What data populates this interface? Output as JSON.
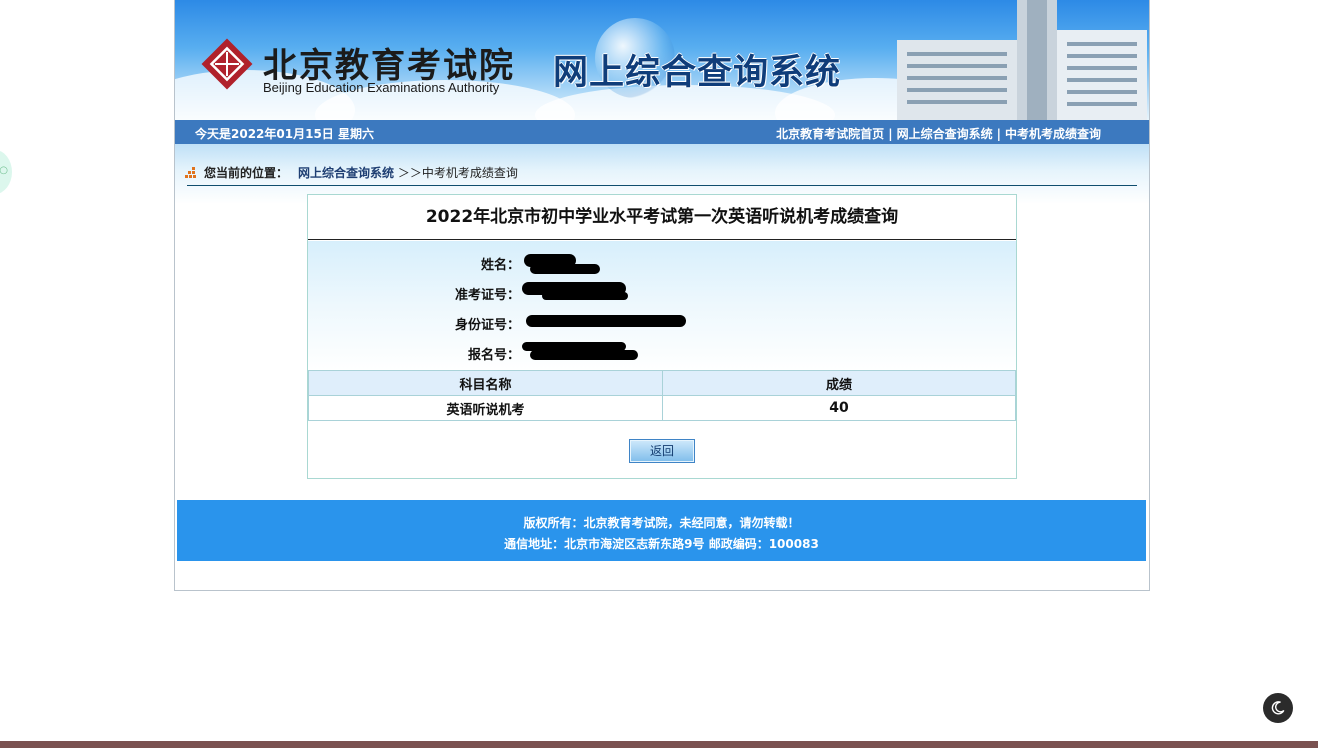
{
  "header": {
    "logo_cn": "北京教育考试院",
    "logo_en": "Beijing Education Examinations Authority",
    "system_title": "网上综合查询系统"
  },
  "navbar": {
    "date_text": "今天是2022年01月15日 星期六",
    "links": [
      "北京教育考试院首页",
      "网上综合查询系统",
      "中考机考成绩查询"
    ],
    "separator": "|"
  },
  "breadcrumb": {
    "label": "您当前的位置：",
    "link": "网上综合查询系统",
    "arrow": "＞＞",
    "current": "中考机考成绩查询"
  },
  "result": {
    "title": "2022年北京市初中学业水平考试第一次英语听说机考成绩查询",
    "fields": [
      {
        "label": "姓名："
      },
      {
        "label": "准考证号："
      },
      {
        "label": "身份证号："
      },
      {
        "label": "报名号："
      }
    ],
    "table": {
      "headers": [
        "科目名称",
        "成绩"
      ],
      "rows": [
        {
          "subject": "英语听说机考",
          "score": "40"
        }
      ]
    },
    "back_button": "返回"
  },
  "footer": {
    "line1": "版权所有：北京教育考试院，未经同意，请勿转载！",
    "line2": "通信地址：北京市海淀区志新东路9号 邮政编码：100083"
  },
  "colors": {
    "navbar": "#3c79bf",
    "footer": "#2a94ec",
    "title_blue": "#0f3d7a"
  },
  "icons": {
    "logo": "bjeea-logo-icon",
    "breadcrumb": "grid-dots-icon",
    "dark_mode": "moon-icon"
  }
}
